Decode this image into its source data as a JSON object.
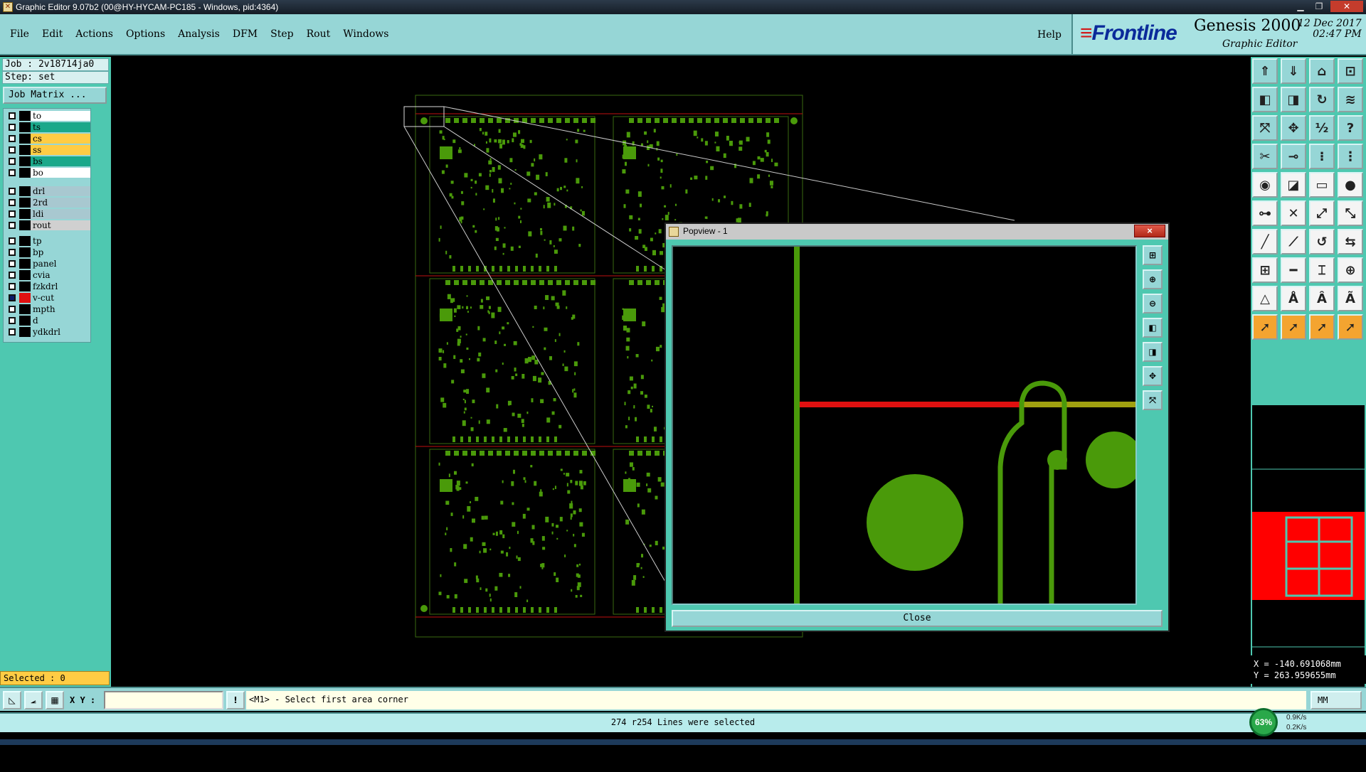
{
  "window": {
    "title": "Graphic Editor 9.07b2 (00@HY-HYCAM-PC185 - Windows, pid:4364)",
    "app_icon": "genesis-app-icon"
  },
  "menu": {
    "items": [
      "File",
      "Edit",
      "Actions",
      "Options",
      "Analysis",
      "DFM",
      "Step",
      "Rout",
      "Windows"
    ],
    "help": "Help"
  },
  "brand": {
    "logo": "Frontline",
    "product": "Genesis 2000",
    "subtitle": "Graphic Editor",
    "date": "12 Dec 2017",
    "time": "02:47 PM"
  },
  "job": {
    "job_line": "Job : 2v18714ja0",
    "step_line": "Step: set",
    "matrix_button": "Job Matrix ..."
  },
  "layers": {
    "board": [
      {
        "name": "to",
        "color": "#ffffff"
      },
      {
        "name": "ts",
        "color": "#1aa88a"
      },
      {
        "name": "cs",
        "color": "#ffcc44"
      },
      {
        "name": "ss",
        "color": "#ffcc44"
      },
      {
        "name": "bs",
        "color": "#1aa88a"
      },
      {
        "name": "bo",
        "color": "#ffffff"
      }
    ],
    "drill": [
      {
        "name": "drl",
        "color": "#a8c8d0"
      },
      {
        "name": "2rd",
        "color": "#a8c8d0"
      },
      {
        "name": "ldi",
        "color": "#a8c8d0"
      },
      {
        "name": "rout",
        "color": "#d0d0d0"
      }
    ],
    "misc": [
      {
        "name": "tp",
        "color": "#96d6d6"
      },
      {
        "name": "bp",
        "color": "#96d6d6"
      },
      {
        "name": "panel",
        "color": "#96d6d6"
      },
      {
        "name": "cvia",
        "color": "#96d6d6"
      },
      {
        "name": "fzkdrl",
        "color": "#96d6d6"
      },
      {
        "name": "v-cut",
        "color": "#96d6d6"
      },
      {
        "name": "mpth",
        "color": "#96d6d6"
      },
      {
        "name": "d",
        "color": "#96d6d6"
      },
      {
        "name": "ydkdrl",
        "color": "#96d6d6"
      }
    ]
  },
  "selected": "Selected : 0",
  "popview": {
    "title": "Popview - 1",
    "close_button": "Close",
    "close_x": "×"
  },
  "coords": {
    "x": "X = -140.691068mm",
    "y": "Y = 263.959655mm"
  },
  "command": {
    "xy_label": "X Y :",
    "xy_value": "",
    "prompt": "<M1> - Select first area corner",
    "units": "MM"
  },
  "status": "274 r254 Lines were selected",
  "network": {
    "percent": "63%",
    "up": "0.9K/s",
    "down": "0.2K/s"
  },
  "colors": {
    "feature_green": "#4a9a0a",
    "profile_red": "#e01010",
    "panel_teal": "#4ec8b0",
    "menu_teal": "#96d6d6"
  }
}
